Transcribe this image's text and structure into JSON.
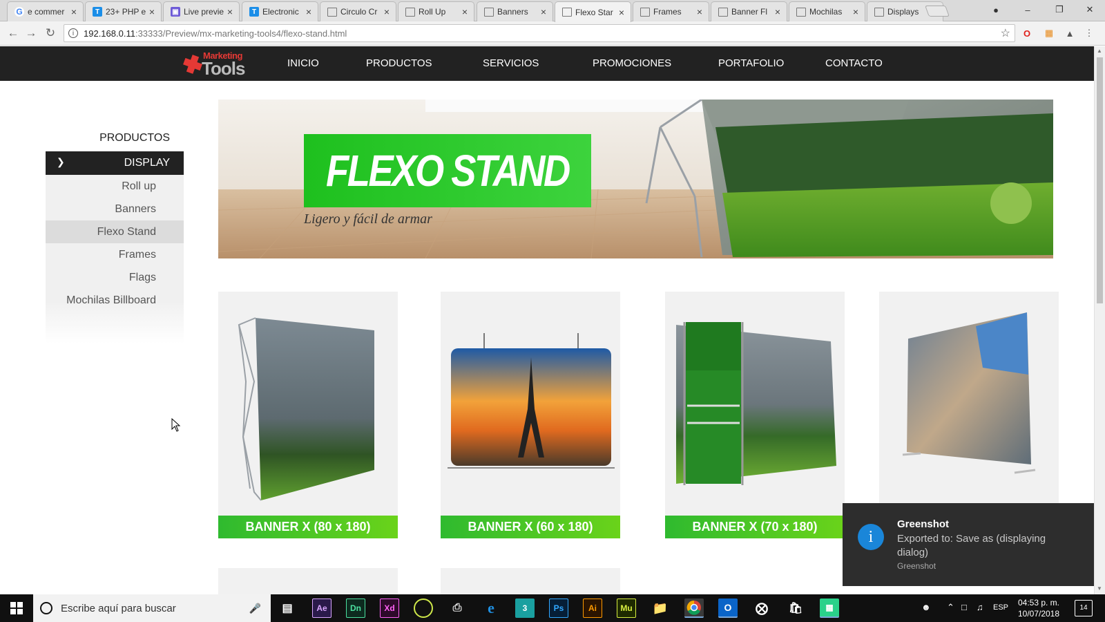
{
  "browser": {
    "tabs": [
      {
        "title": "e commer",
        "icon": "google-icon"
      },
      {
        "title": "23+ PHP e",
        "icon": "t-icon"
      },
      {
        "title": "Live previe",
        "icon": "preview-icon"
      },
      {
        "title": "Electronic",
        "icon": "t-icon"
      },
      {
        "title": "Circulo Cr",
        "icon": "page-icon"
      },
      {
        "title": "Roll Up",
        "icon": "page-icon"
      },
      {
        "title": "Banners",
        "icon": "page-icon"
      },
      {
        "title": "Flexo Star",
        "icon": "page-icon"
      },
      {
        "title": "Frames",
        "icon": "page-icon"
      },
      {
        "title": "Banner Fl",
        "icon": "page-icon"
      },
      {
        "title": "Mochilas",
        "icon": "page-icon"
      },
      {
        "title": "Displays",
        "icon": "page-icon"
      }
    ],
    "active_tab_index": 7,
    "url_host": "192.168.0.11",
    "url_rest": ":33333/Preview/mx-marketing-tools4/flexo-stand.html"
  },
  "site": {
    "logo_line1": "Marketing",
    "logo_line2": "Tools",
    "nav": [
      "INICIO",
      "PRODUCTOS",
      "SERVICIOS",
      "PROMOCIONES",
      "PORTAFOLIO",
      "CONTACTO"
    ]
  },
  "sidebar": {
    "title": "PRODUCTOS",
    "category": "DISPLAY",
    "items": [
      "Roll up",
      "Banners",
      "Flexo Stand",
      "Frames",
      "Flags",
      "Mochilas Billboard"
    ],
    "selected_index": 2
  },
  "hero": {
    "title": "FLEXO STAND",
    "subtitle": "Ligero y fácil de armar"
  },
  "products": [
    {
      "label": "BANNER X (80 x 180)"
    },
    {
      "label": "BANNER X (60 x 180)"
    },
    {
      "label": "BANNER X (70 x 180)"
    },
    {
      "label": ""
    }
  ],
  "toast": {
    "title": "Greenshot",
    "message": "Exported to: Save as (displaying dialog)",
    "source": "Greenshot"
  },
  "taskbar": {
    "search_placeholder": "Escribe aquí para buscar",
    "apps": [
      "Ae",
      "Dn",
      "Xd",
      "",
      "",
      "e",
      "3",
      "Ps",
      "Ai",
      "Mu",
      "",
      "",
      "",
      "",
      "",
      ""
    ],
    "language": "ESP",
    "time": "04:53 p. m.",
    "date": "10/07/2018",
    "notifications": "14"
  },
  "colors": {
    "accent_green": "#3cc63c",
    "header_bg": "#222222",
    "toast_icon": "#1a86d9"
  }
}
